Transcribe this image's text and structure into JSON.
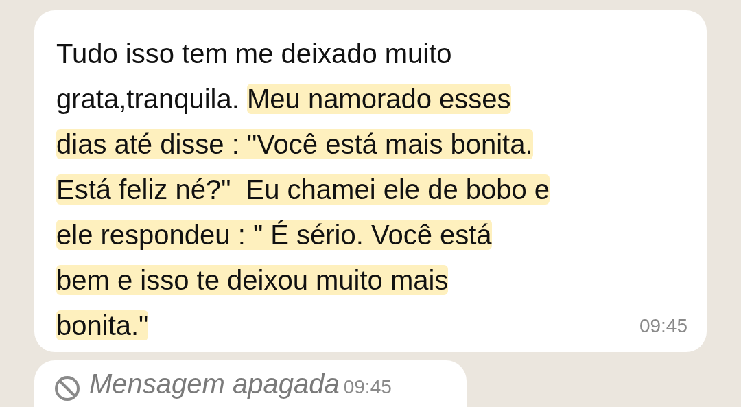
{
  "message": {
    "lines": [
      [
        {
          "text": "Tudo isso tem me deixado muito",
          "highlighted": false
        }
      ],
      [
        {
          "text": "grata,tranquila. ",
          "highlighted": false
        },
        {
          "text": "Meu namorado esses",
          "highlighted": true
        }
      ],
      [
        {
          "text": "dias até disse : \"Você está mais bonita.",
          "highlighted": true
        }
      ],
      [
        {
          "text": "Está feliz né?\"  Eu chamei ele de bobo e",
          "highlighted": true
        }
      ],
      [
        {
          "text": "ele respondeu : \" É sério. Você está",
          "highlighted": true
        }
      ],
      [
        {
          "text": "bem e isso te deixou muito mais",
          "highlighted": true
        }
      ],
      [
        {
          "text": "bonita.\"",
          "highlighted": true
        }
      ]
    ],
    "time": "09:45"
  },
  "deleted_message": {
    "text": "Mensagem apagada",
    "time": "09:45"
  }
}
